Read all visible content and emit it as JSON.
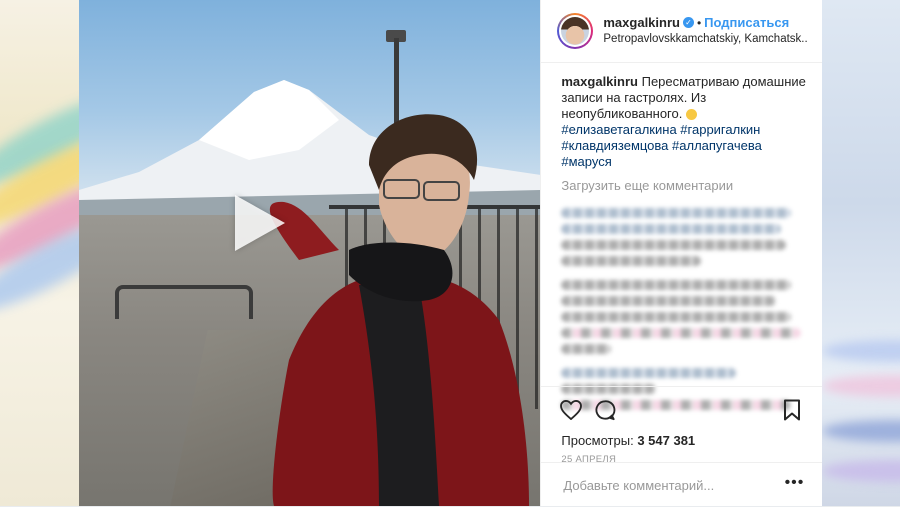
{
  "header": {
    "username": "maxgalkinru",
    "separator": "•",
    "follow_label": "Подписаться",
    "location": "Petropavlovskkamchatskiy, Kamchatsk.."
  },
  "caption": {
    "username": "maxgalkinru",
    "text": "Пересматриваю домашние записи на гастролях. Из неопубликованного.",
    "hashtags": [
      "#елизаветагалкина",
      "#гарригалкин",
      "#клавдияземцова",
      "#аллапугачева",
      "#маруся"
    ]
  },
  "comments": {
    "load_more_label": "Загрузить еще комментарии"
  },
  "stats": {
    "views_label": "Просмотры:",
    "views_count": "3 547 381",
    "date": "25 АПРЕЛЯ"
  },
  "comment_input": {
    "placeholder": "Добавьте комментарий..."
  },
  "icons": {
    "like": "heart-icon",
    "comment": "comment-icon",
    "save": "bookmark-icon",
    "play": "play-icon",
    "verified": "verified-badge-icon",
    "more": "more-options-icon"
  },
  "colors": {
    "accent": "#3897f0",
    "hashtag": "#003569",
    "muted": "#999999"
  }
}
